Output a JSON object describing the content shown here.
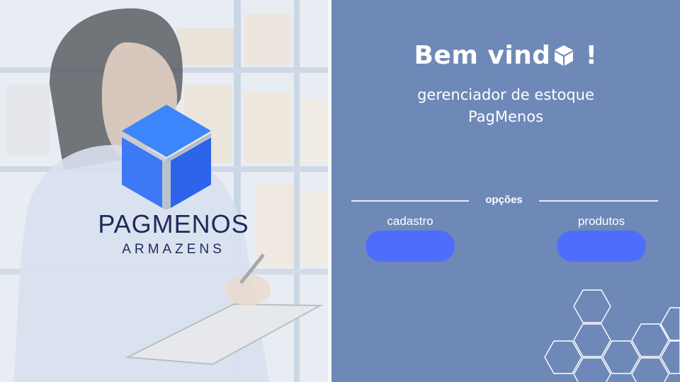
{
  "brand": {
    "name": "PAGMENOS",
    "subtitle": "ARMAZENS"
  },
  "header": {
    "welcome_prefix": "Bem vind",
    "welcome_suffix": " !",
    "tagline_line1": "gerenciador de estoque",
    "tagline_line2": "PagMenos"
  },
  "options": {
    "label": "opções",
    "buttons": [
      {
        "label": "cadastro"
      },
      {
        "label": "produtos"
      }
    ]
  },
  "colors": {
    "panel_bg": "#6e88b8",
    "button": "#4f6dfc",
    "logo_text": "#1d2a5b",
    "cube_top": "#3b7cf6",
    "cube_side": "#2f5fe6"
  },
  "icons": {
    "welcome_o": "cube-icon",
    "logo": "cube-logo-icon",
    "decoration": "hexagon-pattern"
  }
}
